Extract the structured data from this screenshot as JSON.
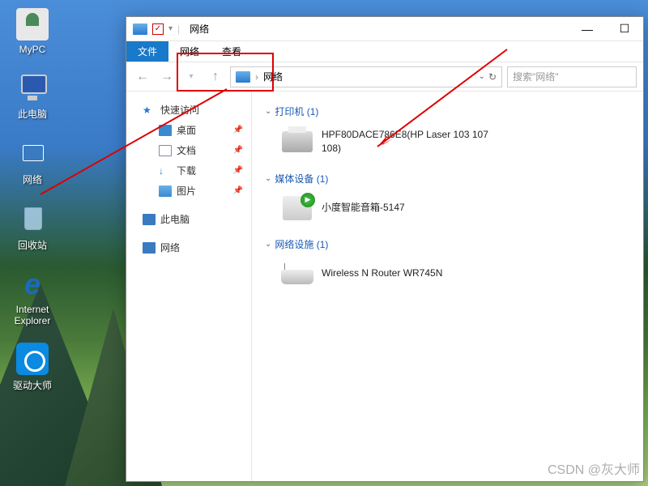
{
  "desktop": {
    "icons": [
      {
        "name": "mypc",
        "label": "MyPC"
      },
      {
        "name": "thispc",
        "label": "此电脑"
      },
      {
        "name": "network",
        "label": "网络"
      },
      {
        "name": "recycle",
        "label": "回收站"
      },
      {
        "name": "ie",
        "label": "Internet Explorer"
      },
      {
        "name": "driver",
        "label": "驱动大师"
      }
    ]
  },
  "window": {
    "title": "网络",
    "ribbon": {
      "file": "文件",
      "network": "网络",
      "view": "查看"
    },
    "address": {
      "location": "网络"
    },
    "search_placeholder": "搜索\"网络\"",
    "win_ctrl": {
      "min": "—",
      "max": "☐",
      "close": "✕",
      "help": "?"
    }
  },
  "sidebar": {
    "quick": {
      "head": "快速访问",
      "items": [
        {
          "k": "desktop",
          "label": "桌面"
        },
        {
          "k": "docs",
          "label": "文档"
        },
        {
          "k": "downloads",
          "label": "下载"
        },
        {
          "k": "pictures",
          "label": "图片"
        }
      ]
    },
    "thispc": "此电脑",
    "network": "网络"
  },
  "content": {
    "categories": [
      {
        "key": "printers",
        "head": "打印机 (1)",
        "items": [
          {
            "label": "HPF80DACE786E8(HP Laser 103 107 108)"
          }
        ]
      },
      {
        "key": "media",
        "head": "媒体设备 (1)",
        "items": [
          {
            "label": "小度智能音箱-5147"
          }
        ]
      },
      {
        "key": "netinfra",
        "head": "网络设施 (1)",
        "items": [
          {
            "label": "Wireless N Router WR745N"
          }
        ]
      }
    ]
  },
  "watermark": "CSDN @灰大师"
}
